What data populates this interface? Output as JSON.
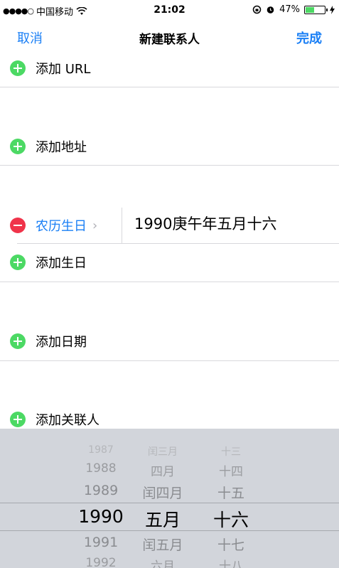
{
  "status": {
    "signal_dots": "●●●●○",
    "carrier": "中国移动",
    "wifi_icon": "wifi-icon",
    "time": "21:02",
    "lock_icon": "rotation-lock-icon",
    "alarm_icon": "alarm-icon",
    "battery_text": "47%",
    "battery_level": 0.47,
    "charging_icon": "bolt-icon"
  },
  "nav": {
    "cancel": "取消",
    "title": "新建联系人",
    "done": "完成"
  },
  "rows": {
    "add_url": "添加 URL",
    "add_address": "添加地址",
    "lunar_birthday_label": "农历生日",
    "lunar_birthday_value": "1990庚午年五月十六",
    "add_birthday": "添加生日",
    "add_date": "添加日期",
    "add_related": "添加关联人"
  },
  "picker": {
    "years": [
      "1987",
      "1988",
      "1989",
      "1990",
      "1991",
      "1992"
    ],
    "months": [
      "闰三月",
      "四月",
      "闰四月",
      "五月",
      "闰五月",
      "六月"
    ],
    "days": [
      "十三",
      "十四",
      "十五",
      "十六",
      "十七",
      "十八"
    ],
    "selected": {
      "year": "1990",
      "month": "五月",
      "day": "十六"
    }
  },
  "colors": {
    "accent": "#1a7ff5",
    "add_green": "#4cd964",
    "remove_red": "#f0334a",
    "picker_bg": "#d2d5db"
  }
}
